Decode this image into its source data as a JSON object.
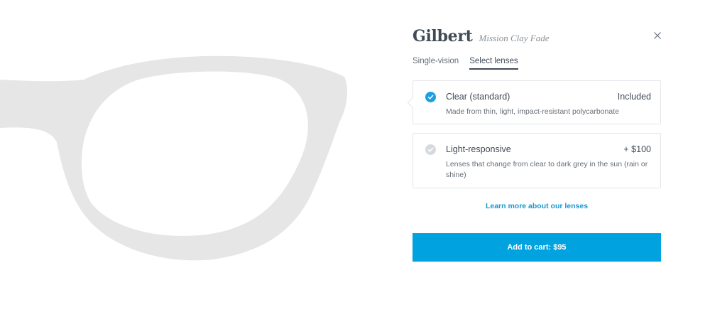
{
  "product": {
    "name": "Gilbert",
    "color": "Mission Clay Fade",
    "image_icon": "eyeglasses-frame-icon"
  },
  "close_icon": "close-icon",
  "steps": [
    {
      "label": "Single-vision",
      "active": false
    },
    {
      "label": "Select lenses",
      "active": true
    }
  ],
  "options": [
    {
      "name": "Clear (standard)",
      "price": "Included",
      "description": "Made from thin, light, impact-resistant polycarbonate",
      "selected": true,
      "icon": "checkmark-icon"
    },
    {
      "name": "Light-responsive",
      "price": "+ $100",
      "description": "Lenses that change from clear to dark grey in the sun (rain or shine)",
      "selected": false,
      "icon": "checkmark-icon"
    }
  ],
  "learn_more": "Learn more about our lenses",
  "cart_button": "Add to cart: $95",
  "colors": {
    "accent": "#00a2e0",
    "link": "#1a97cf",
    "frame": "#e6e6e6",
    "text": "#414b56"
  }
}
